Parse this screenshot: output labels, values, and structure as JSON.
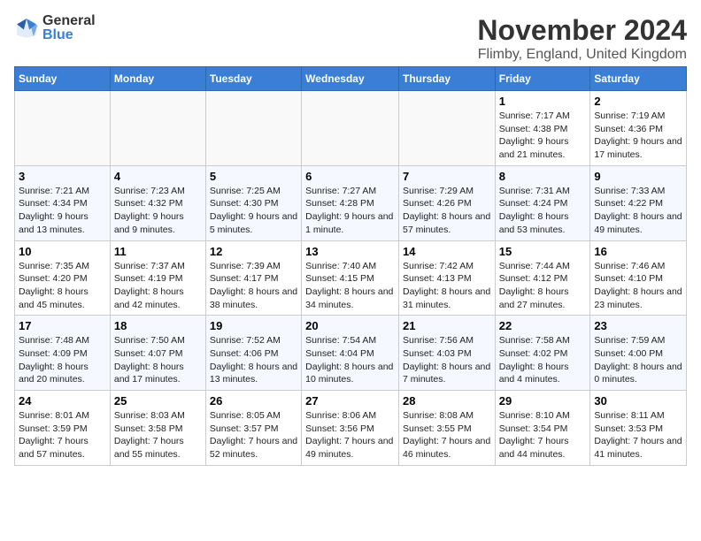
{
  "header": {
    "logo_general": "General",
    "logo_blue": "Blue",
    "month": "November 2024",
    "location": "Flimby, England, United Kingdom"
  },
  "weekdays": [
    "Sunday",
    "Monday",
    "Tuesday",
    "Wednesday",
    "Thursday",
    "Friday",
    "Saturday"
  ],
  "weeks": [
    [
      {
        "day": "",
        "info": ""
      },
      {
        "day": "",
        "info": ""
      },
      {
        "day": "",
        "info": ""
      },
      {
        "day": "",
        "info": ""
      },
      {
        "day": "",
        "info": ""
      },
      {
        "day": "1",
        "info": "Sunrise: 7:17 AM\nSunset: 4:38 PM\nDaylight: 9 hours and 21 minutes."
      },
      {
        "day": "2",
        "info": "Sunrise: 7:19 AM\nSunset: 4:36 PM\nDaylight: 9 hours and 17 minutes."
      }
    ],
    [
      {
        "day": "3",
        "info": "Sunrise: 7:21 AM\nSunset: 4:34 PM\nDaylight: 9 hours and 13 minutes."
      },
      {
        "day": "4",
        "info": "Sunrise: 7:23 AM\nSunset: 4:32 PM\nDaylight: 9 hours and 9 minutes."
      },
      {
        "day": "5",
        "info": "Sunrise: 7:25 AM\nSunset: 4:30 PM\nDaylight: 9 hours and 5 minutes."
      },
      {
        "day": "6",
        "info": "Sunrise: 7:27 AM\nSunset: 4:28 PM\nDaylight: 9 hours and 1 minute."
      },
      {
        "day": "7",
        "info": "Sunrise: 7:29 AM\nSunset: 4:26 PM\nDaylight: 8 hours and 57 minutes."
      },
      {
        "day": "8",
        "info": "Sunrise: 7:31 AM\nSunset: 4:24 PM\nDaylight: 8 hours and 53 minutes."
      },
      {
        "day": "9",
        "info": "Sunrise: 7:33 AM\nSunset: 4:22 PM\nDaylight: 8 hours and 49 minutes."
      }
    ],
    [
      {
        "day": "10",
        "info": "Sunrise: 7:35 AM\nSunset: 4:20 PM\nDaylight: 8 hours and 45 minutes."
      },
      {
        "day": "11",
        "info": "Sunrise: 7:37 AM\nSunset: 4:19 PM\nDaylight: 8 hours and 42 minutes."
      },
      {
        "day": "12",
        "info": "Sunrise: 7:39 AM\nSunset: 4:17 PM\nDaylight: 8 hours and 38 minutes."
      },
      {
        "day": "13",
        "info": "Sunrise: 7:40 AM\nSunset: 4:15 PM\nDaylight: 8 hours and 34 minutes."
      },
      {
        "day": "14",
        "info": "Sunrise: 7:42 AM\nSunset: 4:13 PM\nDaylight: 8 hours and 31 minutes."
      },
      {
        "day": "15",
        "info": "Sunrise: 7:44 AM\nSunset: 4:12 PM\nDaylight: 8 hours and 27 minutes."
      },
      {
        "day": "16",
        "info": "Sunrise: 7:46 AM\nSunset: 4:10 PM\nDaylight: 8 hours and 23 minutes."
      }
    ],
    [
      {
        "day": "17",
        "info": "Sunrise: 7:48 AM\nSunset: 4:09 PM\nDaylight: 8 hours and 20 minutes."
      },
      {
        "day": "18",
        "info": "Sunrise: 7:50 AM\nSunset: 4:07 PM\nDaylight: 8 hours and 17 minutes."
      },
      {
        "day": "19",
        "info": "Sunrise: 7:52 AM\nSunset: 4:06 PM\nDaylight: 8 hours and 13 minutes."
      },
      {
        "day": "20",
        "info": "Sunrise: 7:54 AM\nSunset: 4:04 PM\nDaylight: 8 hours and 10 minutes."
      },
      {
        "day": "21",
        "info": "Sunrise: 7:56 AM\nSunset: 4:03 PM\nDaylight: 8 hours and 7 minutes."
      },
      {
        "day": "22",
        "info": "Sunrise: 7:58 AM\nSunset: 4:02 PM\nDaylight: 8 hours and 4 minutes."
      },
      {
        "day": "23",
        "info": "Sunrise: 7:59 AM\nSunset: 4:00 PM\nDaylight: 8 hours and 0 minutes."
      }
    ],
    [
      {
        "day": "24",
        "info": "Sunrise: 8:01 AM\nSunset: 3:59 PM\nDaylight: 7 hours and 57 minutes."
      },
      {
        "day": "25",
        "info": "Sunrise: 8:03 AM\nSunset: 3:58 PM\nDaylight: 7 hours and 55 minutes."
      },
      {
        "day": "26",
        "info": "Sunrise: 8:05 AM\nSunset: 3:57 PM\nDaylight: 7 hours and 52 minutes."
      },
      {
        "day": "27",
        "info": "Sunrise: 8:06 AM\nSunset: 3:56 PM\nDaylight: 7 hours and 49 minutes."
      },
      {
        "day": "28",
        "info": "Sunrise: 8:08 AM\nSunset: 3:55 PM\nDaylight: 7 hours and 46 minutes."
      },
      {
        "day": "29",
        "info": "Sunrise: 8:10 AM\nSunset: 3:54 PM\nDaylight: 7 hours and 44 minutes."
      },
      {
        "day": "30",
        "info": "Sunrise: 8:11 AM\nSunset: 3:53 PM\nDaylight: 7 hours and 41 minutes."
      }
    ]
  ]
}
